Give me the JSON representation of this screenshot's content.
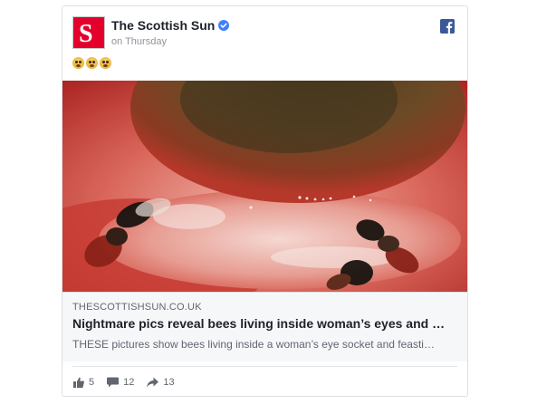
{
  "post": {
    "page_name": "The Scottish Sun",
    "timestamp": "on Thursday",
    "avatar_letter": "S",
    "emoji": [
      "fearful-face",
      "fearful-face",
      "fearful-face"
    ]
  },
  "link": {
    "domain": "THESCOTTISHSUN.CO.UK",
    "headline": "Nightmare pics reveal bees living inside woman’s eyes and …",
    "description": "THESE pictures show bees living inside a woman’s eye socket and feasti…"
  },
  "stats": {
    "likes": "5",
    "comments": "12",
    "shares": "13"
  },
  "colors": {
    "brand": "#e4002b",
    "facebook": "#3b5998",
    "verified": "#4080ff"
  }
}
